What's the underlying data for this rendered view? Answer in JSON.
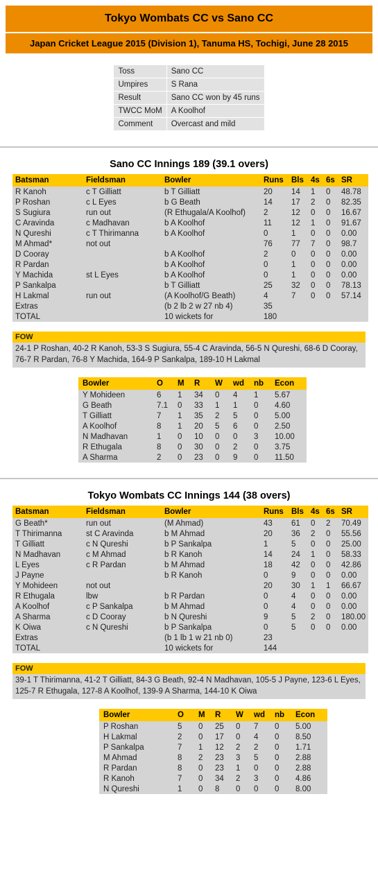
{
  "header": {
    "title": "Tokyo Wombats CC vs Sano CC",
    "subtitle": "Japan Cricket League 2015 (Division 1), Tanuma HS, Tochigi, June 28 2015",
    "accent_orange": "#ed8b00",
    "accent_gold": "#ffc800",
    "row_bg": "#d4d4d4"
  },
  "match_info": {
    "rows": [
      {
        "label": "Toss",
        "value": "Sano CC"
      },
      {
        "label": "Umpires",
        "value": "S Rana"
      },
      {
        "label": "Result",
        "value": "Sano CC won by 45 runs"
      },
      {
        "label": "TWCC MoM",
        "value": "A Koolhof"
      },
      {
        "label": "Comment",
        "value": "Overcast and mild"
      }
    ]
  },
  "batting_columns": [
    "Batsman",
    "Fieldsman",
    "Bowler",
    "Runs",
    "Bls",
    "4s",
    "6s",
    "SR"
  ],
  "bowling_columns": [
    "Bowler",
    "O",
    "M",
    "R",
    "W",
    "wd",
    "nb",
    "Econ"
  ],
  "fow_label": "FOW",
  "innings": [
    {
      "title": "Sano CC Innings 189 (39.1 overs)",
      "batting": [
        {
          "batsman": "R Kanoh",
          "fieldsman": "c T Gilliatt",
          "bowler": "b T Gilliatt",
          "runs": "20",
          "bls": "14",
          "fours": "1",
          "sixes": "0",
          "sr": "48.78"
        },
        {
          "batsman": "P Roshan",
          "fieldsman": "c L Eyes",
          "bowler": "b G Beath",
          "runs": "14",
          "bls": "17",
          "fours": "2",
          "sixes": "0",
          "sr": "82.35"
        },
        {
          "batsman": "S Sugiura",
          "fieldsman": "run out",
          "bowler": "(R Ethugala/A Koolhof)",
          "runs": "2",
          "bls": "12",
          "fours": "0",
          "sixes": "0",
          "sr": "16.67"
        },
        {
          "batsman": "C Aravinda",
          "fieldsman": "c Madhavan",
          "bowler": "b A Koolhof",
          "runs": "11",
          "bls": "12",
          "fours": "1",
          "sixes": "0",
          "sr": "91.67"
        },
        {
          "batsman": "N Qureshi",
          "fieldsman": "c T Thirimanna",
          "bowler": "b A Koolhof",
          "runs": "0",
          "bls": "1",
          "fours": "0",
          "sixes": "0",
          "sr": "0.00"
        },
        {
          "batsman": "M Ahmad*",
          "fieldsman": "not out",
          "bowler": "",
          "runs": "76",
          "bls": "77",
          "fours": "7",
          "sixes": "0",
          "sr": "98.7"
        },
        {
          "batsman": "D Cooray",
          "fieldsman": "",
          "bowler": "b A Koolhof",
          "runs": "2",
          "bls": "0",
          "fours": "0",
          "sixes": "0",
          "sr": "0.00"
        },
        {
          "batsman": "R Pardan",
          "fieldsman": "",
          "bowler": "b A Koolhof",
          "runs": "0",
          "bls": "1",
          "fours": "0",
          "sixes": "0",
          "sr": "0.00"
        },
        {
          "batsman": "Y Machida",
          "fieldsman": "st L Eyes",
          "bowler": "b A Koolhof",
          "runs": "0",
          "bls": "1",
          "fours": "0",
          "sixes": "0",
          "sr": "0.00"
        },
        {
          "batsman": "P Sankalpa",
          "fieldsman": "",
          "bowler": "b T Gilliatt",
          "runs": "25",
          "bls": "32",
          "fours": "0",
          "sixes": "0",
          "sr": "78.13"
        },
        {
          "batsman": "H Lakmal",
          "fieldsman": "run out",
          "bowler": "(A Koolhof/G Beath)",
          "runs": "4",
          "bls": "7",
          "fours": "0",
          "sixes": "0",
          "sr": "57.14"
        },
        {
          "batsman": "Extras",
          "fieldsman": "",
          "bowler": "(b 2 lb 2 w 27 nb 4)",
          "runs": "35",
          "bls": "",
          "fours": "",
          "sixes": "",
          "sr": ""
        },
        {
          "batsman": "TOTAL",
          "fieldsman": "",
          "bowler": "10 wickets for",
          "runs": "180",
          "bls": "",
          "fours": "",
          "sixes": "",
          "sr": ""
        }
      ],
      "fow": "24-1 P Roshan, 40-2 R Kanoh, 53-3 S Sugiura, 55-4 C Aravinda, 56-5 N Qureshi, 68-6 D Cooray, 76-7 R Pardan, 76-8 Y Machida, 164-9 P Sankalpa, 189-10 H Lakmal",
      "bowling": [
        {
          "bowler": "Y Mohideen",
          "o": "6",
          "m": "1",
          "r": "34",
          "w": "0",
          "wd": "4",
          "nb": "1",
          "econ": "5.67"
        },
        {
          "bowler": "G Beath",
          "o": "7.1",
          "m": "0",
          "r": "33",
          "w": "1",
          "wd": "1",
          "nb": "0",
          "econ": "4.60"
        },
        {
          "bowler": "T Gilliatt",
          "o": "7",
          "m": "1",
          "r": "35",
          "w": "2",
          "wd": "5",
          "nb": "0",
          "econ": "5.00"
        },
        {
          "bowler": "A Koolhof",
          "o": "8",
          "m": "1",
          "r": "20",
          "w": "5",
          "wd": "6",
          "nb": "0",
          "econ": "2.50"
        },
        {
          "bowler": "N Madhavan",
          "o": "1",
          "m": "0",
          "r": "10",
          "w": "0",
          "wd": "0",
          "nb": "3",
          "econ": "10.00"
        },
        {
          "bowler": "R Ethugala",
          "o": "8",
          "m": "0",
          "r": "30",
          "w": "0",
          "wd": "2",
          "nb": "0",
          "econ": "3.75"
        },
        {
          "bowler": "A Sharma",
          "o": "2",
          "m": "0",
          "r": "23",
          "w": "0",
          "wd": "9",
          "nb": "0",
          "econ": "11.50"
        }
      ]
    },
    {
      "title": "Tokyo Wombats CC Innings 144 (38 overs)",
      "batting": [
        {
          "batsman": "G Beath*",
          "fieldsman": "run out",
          "bowler": "(M Ahmad)",
          "runs": "43",
          "bls": "61",
          "fours": "0",
          "sixes": "2",
          "sr": "70.49"
        },
        {
          "batsman": "T Thirimanna",
          "fieldsman": "st C Aravinda",
          "bowler": "b M Ahmad",
          "runs": "20",
          "bls": "36",
          "fours": "2",
          "sixes": "0",
          "sr": "55.56"
        },
        {
          "batsman": "T Gilliatt",
          "fieldsman": "c N Qureshi",
          "bowler": "b P Sankalpa",
          "runs": "1",
          "bls": "5",
          "fours": "0",
          "sixes": "0",
          "sr": "25.00"
        },
        {
          "batsman": "N Madhavan",
          "fieldsman": "c M Ahmad",
          "bowler": "b R Kanoh",
          "runs": "14",
          "bls": "24",
          "fours": "1",
          "sixes": "0",
          "sr": "58.33"
        },
        {
          "batsman": "L Eyes",
          "fieldsman": "c R Pardan",
          "bowler": "b M Ahmad",
          "runs": "18",
          "bls": "42",
          "fours": "0",
          "sixes": "0",
          "sr": "42.86"
        },
        {
          "batsman": "J Payne",
          "fieldsman": "",
          "bowler": "b R Kanoh",
          "runs": "0",
          "bls": "9",
          "fours": "0",
          "sixes": "0",
          "sr": "0.00"
        },
        {
          "batsman": "Y Mohideen",
          "fieldsman": "not out",
          "bowler": "",
          "runs": "20",
          "bls": "30",
          "fours": "1",
          "sixes": "1",
          "sr": "66.67"
        },
        {
          "batsman": "R Ethugala",
          "fieldsman": "lbw",
          "bowler": "b R Pardan",
          "runs": "0",
          "bls": "4",
          "fours": "0",
          "sixes": "0",
          "sr": "0.00"
        },
        {
          "batsman": "A Koolhof",
          "fieldsman": "c P Sankalpa",
          "bowler": "b M Ahmad",
          "runs": "0",
          "bls": "4",
          "fours": "0",
          "sixes": "0",
          "sr": "0.00"
        },
        {
          "batsman": "A Sharma",
          "fieldsman": "c D Cooray",
          "bowler": "b N Qureshi",
          "runs": "9",
          "bls": "5",
          "fours": "2",
          "sixes": "0",
          "sr": "180.00"
        },
        {
          "batsman": "K Oiwa",
          "fieldsman": "c N Qureshi",
          "bowler": "b P Sankalpa",
          "runs": "0",
          "bls": "5",
          "fours": "0",
          "sixes": "0",
          "sr": "0.00"
        },
        {
          "batsman": "Extras",
          "fieldsman": "",
          "bowler": "(b 1 lb 1 w 21 nb 0)",
          "runs": "23",
          "bls": "",
          "fours": "",
          "sixes": "",
          "sr": ""
        },
        {
          "batsman": "TOTAL",
          "fieldsman": "",
          "bowler": "10 wickets for",
          "runs": "144",
          "bls": "",
          "fours": "",
          "sixes": "",
          "sr": ""
        }
      ],
      "fow": "39-1 T Thirimanna, 41-2 T Gilliatt, 84-3 G Beath, 92-4 N Madhavan, 105-5 J Payne, 123-6 L Eyes, 125-7 R Ethugala, 127-8 A Koolhof, 139-9 A Sharma, 144-10 K Oiwa",
      "bowling": [
        {
          "bowler": "P Roshan",
          "o": "5",
          "m": "0",
          "r": "25",
          "w": "0",
          "wd": "7",
          "nb": "0",
          "econ": "5.00"
        },
        {
          "bowler": "H Lakmal",
          "o": "2",
          "m": "0",
          "r": "17",
          "w": "0",
          "wd": "4",
          "nb": "0",
          "econ": "8.50"
        },
        {
          "bowler": "P Sankalpa",
          "o": "7",
          "m": "1",
          "r": "12",
          "w": "2",
          "wd": "2",
          "nb": "0",
          "econ": "1.71"
        },
        {
          "bowler": "M Ahmad",
          "o": "8",
          "m": "2",
          "r": "23",
          "w": "3",
          "wd": "5",
          "nb": "0",
          "econ": "2.88"
        },
        {
          "bowler": "R Pardan",
          "o": "8",
          "m": "0",
          "r": "23",
          "w": "1",
          "wd": "0",
          "nb": "0",
          "econ": "2.88"
        },
        {
          "bowler": "R Kanoh",
          "o": "7",
          "m": "0",
          "r": "34",
          "w": "2",
          "wd": "3",
          "nb": "0",
          "econ": "4.86"
        },
        {
          "bowler": "N Qureshi",
          "o": "1",
          "m": "0",
          "r": "8",
          "w": "0",
          "wd": "0",
          "nb": "0",
          "econ": "8.00"
        }
      ]
    }
  ]
}
